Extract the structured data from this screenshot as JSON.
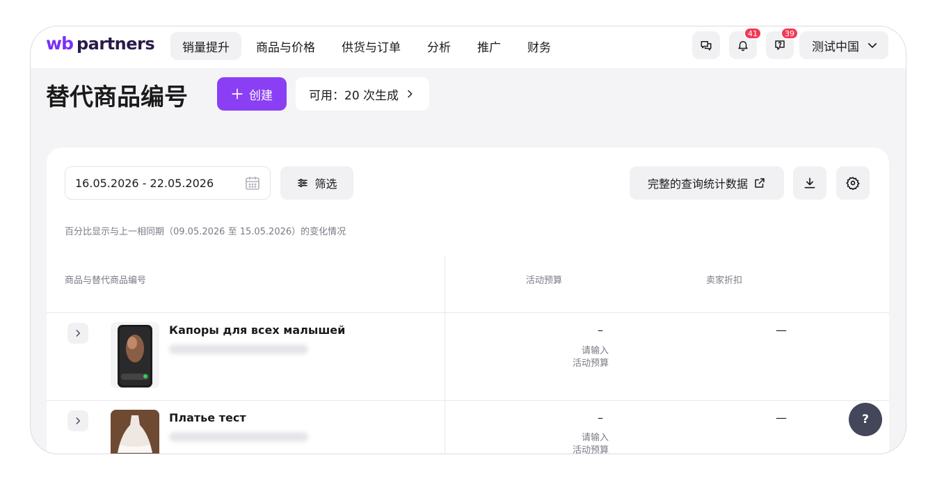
{
  "logo": {
    "wb": "wb",
    "partners": "partners"
  },
  "nav": [
    {
      "label": "销量提升",
      "active": true
    },
    {
      "label": "商品与价格"
    },
    {
      "label": "供货与订单"
    },
    {
      "label": "分析"
    },
    {
      "label": "推广"
    },
    {
      "label": "财务"
    }
  ],
  "header": {
    "chat_icon": "chat-icon",
    "notifications_count": "41",
    "support_count": "39",
    "account_label": "测试中国"
  },
  "page": {
    "title": "替代商品编号",
    "create_label": "创建",
    "quota_label": "可用：20 次生成"
  },
  "toolbar": {
    "date_range": "16.05.2026 - 22.05.2026",
    "filter_label": "筛选",
    "stats_label": "完整的查询统计数据"
  },
  "period_note": "百分比显示与上一相同期（09.05.2026 至 15.05.2026）的变化情况",
  "table": {
    "headers": [
      "商品与替代商品编号",
      "活动预算",
      "卖家折扣"
    ],
    "rows": [
      {
        "name": "Капоры для всех малышей",
        "budget": "–",
        "budget_hint_1": "请输入",
        "budget_hint_2": "活动预算",
        "discount": "—"
      },
      {
        "name": "Платье тест",
        "budget": "–",
        "budget_hint_1": "请输入",
        "budget_hint_2": "活动预算",
        "discount": "—"
      }
    ]
  },
  "help_label": "?",
  "colors": {
    "accent": "#8b3ff5",
    "badge": "#f23a55",
    "brand_wb": "#7b2ff7"
  }
}
